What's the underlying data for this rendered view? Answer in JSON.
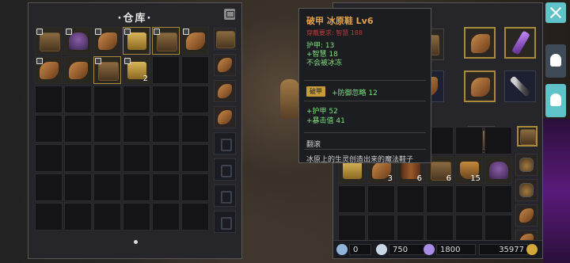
{
  "warehouse": {
    "title": "·仓库·",
    "slots": [
      {
        "icon": "chest-icon",
        "kind": "chest",
        "locked": true
      },
      {
        "icon": "helmet-icon",
        "kind": "helm",
        "locked": true
      },
      {
        "icon": "boots-icon",
        "kind": "boot",
        "locked": true
      },
      {
        "icon": "scroll-icon",
        "kind": "scroll",
        "locked": true,
        "gold": true
      },
      {
        "icon": "chest-icon",
        "kind": "chest",
        "locked": true,
        "gold": true
      },
      {
        "icon": "boots-icon",
        "kind": "boot",
        "locked": true
      },
      {
        "icon": "boots-icon",
        "kind": "boot",
        "locked": true
      },
      {
        "icon": "boots-icon",
        "kind": "boot"
      },
      {
        "icon": "chest-icon",
        "kind": "chest",
        "locked": true,
        "gold": true
      },
      {
        "icon": "scroll-icon",
        "kind": "scroll",
        "locked": true,
        "count": "2"
      }
    ],
    "total_slots": 42
  },
  "tooltip": {
    "title": "破甲 冰原鞋 Lv6",
    "requirement": "穿戴要求: 智慧 188",
    "stats": [
      "护甲: 13",
      "+智慧 18",
      "不会被冰冻"
    ],
    "rune_tag": "破甲",
    "rune_text": "+防御忽略 12",
    "extra_stats": [
      "+护甲 52",
      "+暴击值 41"
    ],
    "set_label": "翻滚",
    "description": "冰原上的生灵创造出来的魔法鞋子"
  },
  "bag": {
    "slots_top": [
      {
        "icon": "scroll-icon",
        "kind": "scroll"
      },
      {
        "icon": "boots-icon",
        "kind": "boot",
        "count": "3"
      },
      {
        "icon": "belt-icon",
        "kind": "belt",
        "count": "6"
      },
      {
        "icon": "chest-icon",
        "kind": "chest",
        "count": "6"
      },
      {
        "icon": "relic-icon",
        "kind": "relic",
        "count": "15"
      },
      {
        "icon": "character-portrait-icon",
        "kind": "helm"
      }
    ],
    "footer": {
      "value1": "0",
      "value2": "750",
      "value3": "1800",
      "value4": "35977"
    }
  }
}
